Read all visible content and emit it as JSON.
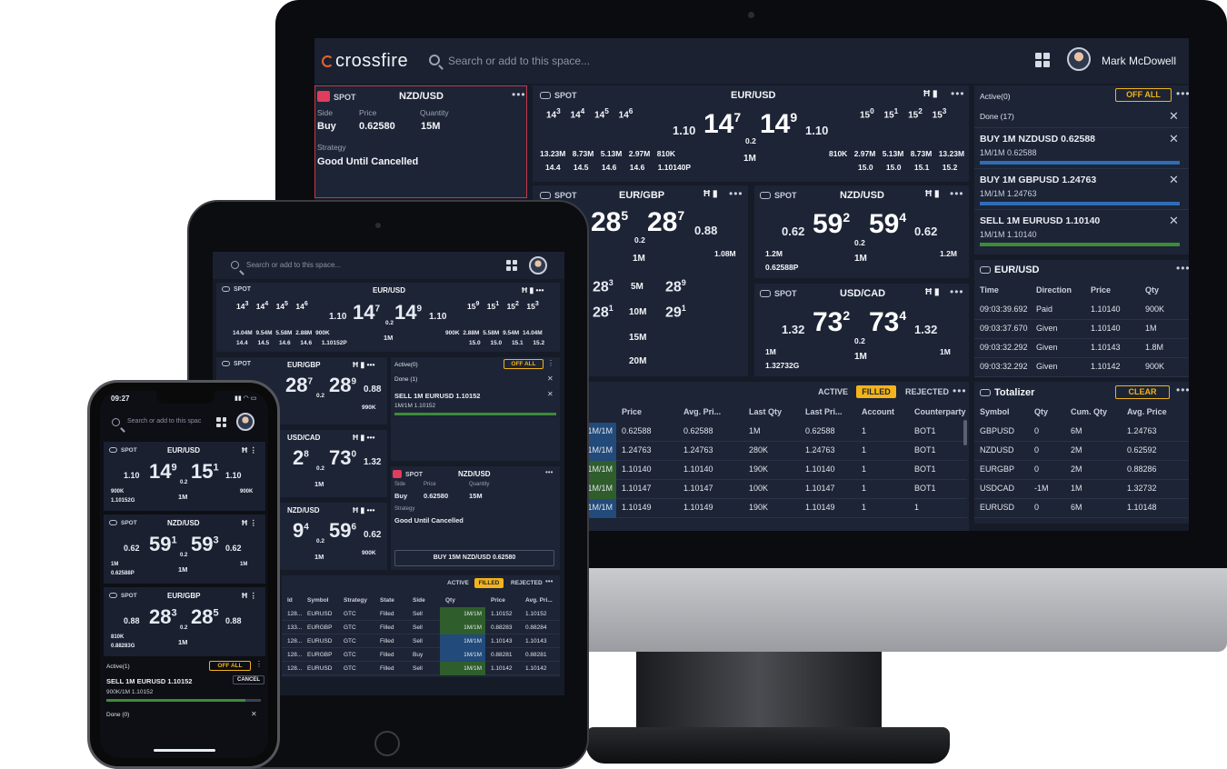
{
  "desktop": {
    "brand": "crossfire",
    "search_placeholder": "Search or add to this space...",
    "user": "Mark McDowell",
    "order_tile": {
      "tag": "SPOT",
      "pair": "NZD/USD",
      "side_label": "Side",
      "side": "Buy",
      "price_label": "Price",
      "price": "0.62580",
      "qty_label": "Quantity",
      "qty": "15M",
      "strategy_label": "Strategy",
      "strategy": "Good Until Cancelled"
    },
    "eurusd": {
      "tag": "SPOT",
      "pair": "EUR/USD",
      "ladder_left": [
        "14",
        "14",
        "14",
        "14"
      ],
      "ladder_left_sup": [
        "3",
        "4",
        "5",
        "6"
      ],
      "ladder_right": [
        "15",
        "15",
        "15",
        "15"
      ],
      "ladder_right_sup": [
        "0",
        "1",
        "2",
        "3"
      ],
      "bid_big": "14",
      "bid_sup": "7",
      "bid_prefix": "1.10",
      "ask_big": "14",
      "ask_sup": "9",
      "ask_suffix": "1.10",
      "spread": "0.2",
      "vol_left": [
        "13.23M",
        "8.73M",
        "5.13M",
        "2.97M",
        "810K"
      ],
      "px_left": [
        "14.4",
        "14.5",
        "14.6",
        "14.6",
        "1.10140P"
      ],
      "mid_qty": "1M",
      "vol_right": [
        "810K",
        "2.97M",
        "5.13M",
        "8.73M",
        "13.23M"
      ],
      "px_right": [
        "15.0",
        "15.0",
        "15.1",
        "15.2"
      ]
    },
    "eurgbp": {
      "tag": "SPOT",
      "pair": "EUR/GBP",
      "bid_big": "28",
      "bid_sup": "5",
      "ask_big": "28",
      "ask_sup": "7",
      "ask_suffix": "0.88",
      "spread": "0.2",
      "right_vol": "1.08M",
      "mid_qty": "1M",
      "ladder": [
        [
          "28",
          "3",
          "5M",
          "28",
          "9"
        ],
        [
          "28",
          "1",
          "10M",
          "29",
          "1"
        ],
        [
          "",
          "",
          "15M",
          "",
          ""
        ],
        [
          "",
          "",
          "20M",
          "",
          ""
        ]
      ]
    },
    "nzdusd": {
      "tag": "SPOT",
      "pair": "NZD/USD",
      "bid_prefix": "0.62",
      "bid_big": "59",
      "bid_sup": "2",
      "ask_big": "59",
      "ask_sup": "4",
      "ask_suffix": "0.62",
      "spread": "0.2",
      "left_vol": "1.2M",
      "left_px": "0.62588P",
      "mid_qty": "1M",
      "right_vol": "1.2M"
    },
    "usdcad": {
      "tag": "SPOT",
      "pair": "USD/CAD",
      "bid_prefix": "1.32",
      "bid_big": "73",
      "bid_sup": "2",
      "ask_big": "73",
      "ask_sup": "4",
      "ask_suffix": "1.32",
      "spread": "0.2",
      "left_vol": "1M",
      "left_px": "1.32732G",
      "mid_qty": "1M",
      "right_vol": "1M"
    },
    "orders": {
      "active": "Active(0)",
      "off_all": "OFF ALL",
      "done": "Done (17)",
      "items": [
        {
          "title": "BUY 1M NZDUSD 0.62588",
          "sub": "1M/1M 0.62588",
          "bar": "b"
        },
        {
          "title": "BUY 1M GBPUSD 1.24763",
          "sub": "1M/1M 1.24763",
          "bar": "b"
        },
        {
          "title": "SELL 1M EURUSD 1.10140",
          "sub": "1M/1M 1.10140",
          "bar": "g"
        }
      ]
    },
    "trades": {
      "title": "EUR/USD",
      "cols": [
        "Time",
        "Direction",
        "Price",
        "Qty"
      ],
      "rows": [
        [
          "09:03:39.692",
          "Paid",
          "1.10140",
          "900K"
        ],
        [
          "09:03:37.670",
          "Given",
          "1.10140",
          "1M"
        ],
        [
          "09:03:32.292",
          "Given",
          "1.10143",
          "1.8M"
        ],
        [
          "09:03:32.292",
          "Given",
          "1.10142",
          "900K"
        ]
      ]
    },
    "blotter": {
      "tabs": [
        "ACTIVE",
        "FILLED",
        "REJECTED"
      ],
      "cols": [
        "Qty",
        "Price",
        "Avg. Pri...",
        "Last Qty",
        "Last Pri...",
        "Account",
        "Counterparty"
      ],
      "rows": [
        [
          "1M/1M",
          "0.62588",
          "0.62588",
          "1M",
          "0.62588",
          "1",
          "BOT1",
          "b"
        ],
        [
          "1M/1M",
          "1.24763",
          "1.24763",
          "280K",
          "1.24763",
          "1",
          "BOT1",
          "b"
        ],
        [
          "1M/1M",
          "1.10140",
          "1.10140",
          "190K",
          "1.10140",
          "1",
          "BOT1",
          "g"
        ],
        [
          "1M/1M",
          "1.10147",
          "1.10147",
          "100K",
          "1.10147",
          "1",
          "BOT1",
          "g"
        ],
        [
          "1M/1M",
          "1.10149",
          "1.10149",
          "190K",
          "1.10149",
          "1",
          "1",
          "b"
        ]
      ]
    },
    "totalizer": {
      "title": "Totalizer",
      "clear": "CLEAR",
      "cols": [
        "Symbol",
        "Qty",
        "Cum. Qty",
        "Avg. Price"
      ],
      "rows": [
        [
          "GBPUSD",
          "0",
          "6M",
          "1.24763"
        ],
        [
          "NZDUSD",
          "0",
          "2M",
          "0.62592"
        ],
        [
          "EURGBP",
          "0",
          "2M",
          "0.88286"
        ],
        [
          "USDCAD",
          "-1M",
          "1M",
          "1.32732"
        ],
        [
          "EURUSD",
          "0",
          "6M",
          "1.10148"
        ]
      ]
    }
  },
  "tablet": {
    "search_placeholder": "Search or add to this space...",
    "eurusd": {
      "tag": "SPOT",
      "pair": "EUR/USD",
      "left": [
        "14",
        "14",
        "14",
        "14"
      ],
      "left_sup": [
        "3",
        "4",
        "5",
        "6"
      ],
      "right": [
        "15",
        "15",
        "15",
        "15"
      ],
      "right_sup": [
        "9",
        "1",
        "2",
        "3"
      ],
      "bid_prefix": "1.10",
      "bid_big": "14",
      "bid_sup": "7",
      "ask_big": "14",
      "ask_sup": "9",
      "ask_suffix": "1.10",
      "spread": "0.2",
      "vol_left": [
        "14.04M",
        "9.54M",
        "5.58M",
        "2.88M",
        "900K"
      ],
      "px_left": [
        "14.4",
        "14.5",
        "14.6",
        "14.6",
        "1.10152P"
      ],
      "mid": "1M",
      "vol_right": [
        "900K",
        "2.88M",
        "5.58M",
        "9.54M",
        "14.04M"
      ],
      "px_right": [
        "15.0",
        "15.0",
        "15.1",
        "15.2"
      ]
    },
    "eurgbp": {
      "tag": "SPOT",
      "pair": "EUR/GBP",
      "bid_big": "28",
      "bid_sup": "7",
      "ask_big": "28",
      "ask_sup": "9",
      "ask_suffix": "0.88",
      "spread": "0.2",
      "vol": "990K"
    },
    "usdcad": {
      "pair": "USD/CAD",
      "bid_big": "2",
      "bid_sup": "8",
      "ask_big": "73",
      "ask_sup": "0",
      "ask_suffix": "1.32",
      "spread": "0.2",
      "mid": "1M"
    },
    "nzdusd": {
      "pair": "NZD/USD",
      "bid_big": "9",
      "bid_sup": "4",
      "ask_big": "59",
      "ask_sup": "6",
      "ask_suffix": "0.62",
      "spread": "0.2",
      "mid": "1M",
      "vol": "900K"
    },
    "orders": {
      "active": "Active(0)",
      "off_all": "OFF ALL",
      "done": "Done (1)",
      "item": "SELL 1M EURUSD 1.10152",
      "sub": "1M/1M 1.10152"
    },
    "order_tile": {
      "tag": "SPOT",
      "pair": "NZD/USD",
      "side_label": "Side",
      "side": "Buy",
      "price_label": "Price",
      "price": "0.62580",
      "qty_label": "Quantity",
      "qty": "15M",
      "strategy_label": "Strategy",
      "strategy": "Good Until Cancelled",
      "submit": "BUY 15M NZD/USD 0.62580"
    },
    "blotter": {
      "tabs": [
        "ACTIVE",
        "FILLED",
        "REJECTED"
      ],
      "cols": [
        "Id",
        "Symbol",
        "Strategy",
        "State",
        "Side",
        "Qty",
        "Price",
        "Avg. Pri..."
      ],
      "rows": [
        [
          "128...",
          "EURUSD",
          "GTC",
          "Filled",
          "Sell",
          "1M/1M",
          "1.10152",
          "1.10152",
          "g"
        ],
        [
          "133...",
          "EURGBP",
          "GTC",
          "Filled",
          "Sell",
          "1M/1M",
          "0.88283",
          "0.88284",
          "g"
        ],
        [
          "128...",
          "EURUSD",
          "GTC",
          "Filled",
          "Sell",
          "1M/1M",
          "1.10143",
          "1.10143",
          "b"
        ],
        [
          "128...",
          "EURGBP",
          "GTC",
          "Filled",
          "Buy",
          "1M/1M",
          "0.88281",
          "0.88281",
          "b"
        ],
        [
          "128...",
          "EURUSD",
          "GTC",
          "Filled",
          "Sell",
          "1M/1M",
          "1.10142",
          "1.10142",
          "g"
        ]
      ]
    }
  },
  "phone": {
    "time": "09:27",
    "search_placeholder": "Search or add to this spac",
    "tiles": [
      {
        "tag": "SPOT",
        "pair": "EUR/USD",
        "prefix": "1.10",
        "bid_big": "14",
        "bid_sup": "9",
        "ask_big": "15",
        "ask_sup": "1",
        "suffix": "1.10",
        "spread": "0.2",
        "lv": "900K",
        "lp": "1.10152G",
        "mid": "1M",
        "rv": "900K"
      },
      {
        "tag": "SPOT",
        "pair": "NZD/USD",
        "prefix": "0.62",
        "bid_big": "59",
        "bid_sup": "1",
        "ask_big": "59",
        "ask_sup": "3",
        "suffix": "0.62",
        "spread": "0.2",
        "lv": "1M",
        "lp": "0.62588P",
        "mid": "1M",
        "rv": "1M"
      },
      {
        "tag": "SPOT",
        "pair": "EUR/GBP",
        "prefix": "0.88",
        "bid_big": "28",
        "bid_sup": "3",
        "ask_big": "28",
        "ask_sup": "5",
        "suffix": "0.88",
        "spread": "0.2",
        "lv": "810K",
        "lp": "0.88283G",
        "mid": "1M",
        "rv": ""
      }
    ],
    "orders": {
      "active": "Active(1)",
      "off_all": "OFF ALL",
      "item": "SELL 1M EURUSD 1.10152",
      "cancel": "CANCEL",
      "sub": "900K/1M 1.10152",
      "done": "Done (0)",
      "progress": 0.9
    }
  },
  "colors": {
    "accent": "#f2b31b",
    "bg": "#161b28",
    "tile": "#1d2435",
    "buy": "#2d6db8",
    "sell": "#3f8a3a",
    "brand": "#e8632b"
  }
}
